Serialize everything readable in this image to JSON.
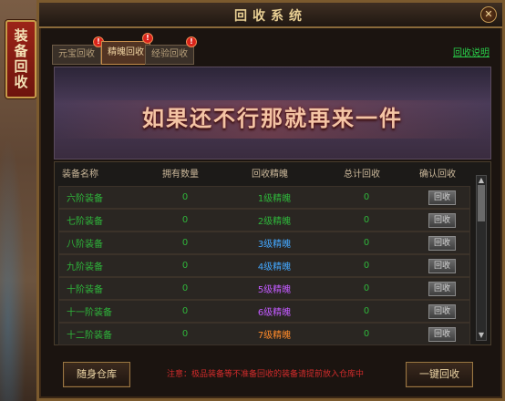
{
  "side_tab": {
    "label": "装备回收"
  },
  "window": {
    "title": "回收系统",
    "close_symbol": "✕"
  },
  "tabs": [
    {
      "label": "元宝回收",
      "badge": "!"
    },
    {
      "label": "精魄回收",
      "badge": "!"
    },
    {
      "label": "经验回收",
      "badge": "!"
    }
  ],
  "help_link": "回收说明",
  "banner": {
    "text": "如果还不行那就再来一件"
  },
  "table": {
    "headers": [
      "装备名称",
      "拥有数量",
      "回收精魄",
      "总计回收",
      "确认回收"
    ],
    "rows": [
      {
        "name": "六阶装备",
        "count": "0",
        "soul": "1级精魄",
        "total": "0",
        "action": "回收",
        "soul_color": "#2fb63b"
      },
      {
        "name": "七阶装备",
        "count": "0",
        "soul": "2级精魄",
        "total": "0",
        "action": "回收",
        "soul_color": "#2fb63b"
      },
      {
        "name": "八阶装备",
        "count": "0",
        "soul": "3级精魄",
        "total": "0",
        "action": "回收",
        "soul_color": "#44a8ff"
      },
      {
        "name": "九阶装备",
        "count": "0",
        "soul": "4级精魄",
        "total": "0",
        "action": "回收",
        "soul_color": "#44a8ff"
      },
      {
        "name": "十阶装备",
        "count": "0",
        "soul": "5级精魄",
        "total": "0",
        "action": "回收",
        "soul_color": "#c25bff"
      },
      {
        "name": "十一阶装备",
        "count": "0",
        "soul": "6级精魄",
        "total": "0",
        "action": "回收",
        "soul_color": "#c25bff"
      },
      {
        "name": "十二阶装备",
        "count": "0",
        "soul": "7级精魄",
        "total": "0",
        "action": "回收",
        "soul_color": "#ff8a2a"
      }
    ]
  },
  "footer": {
    "left_button": "随身仓库",
    "note": "注意：极品装备等不准备回收的装备请提前放入仓库中",
    "right_button": "一键回收"
  },
  "colors": {
    "accent": "#c58d4b",
    "green": "#2fb63b",
    "warning": "#d12b2b"
  }
}
